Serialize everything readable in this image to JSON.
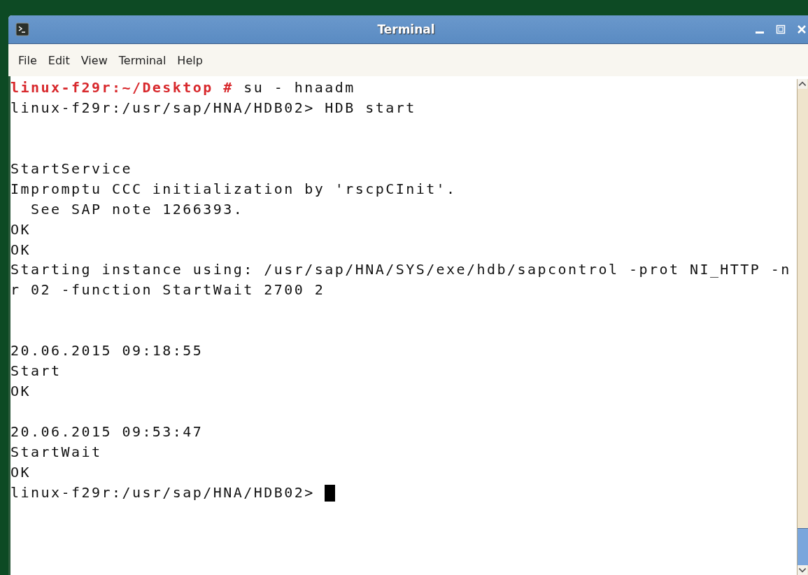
{
  "window": {
    "title": "Terminal"
  },
  "menu": [
    "File",
    "Edit",
    "View",
    "Terminal",
    "Help"
  ],
  "lines": [
    {
      "kind": "root_prompt",
      "prompt": "linux-f29r:~/Desktop #",
      "command": " su - hnaadm"
    },
    {
      "kind": "output",
      "text": "linux-f29r:/usr/sap/HNA/HDB02> HDB start"
    },
    {
      "kind": "blank"
    },
    {
      "kind": "blank"
    },
    {
      "kind": "output",
      "text": "StartService"
    },
    {
      "kind": "output",
      "text": "Impromptu CCC initialization by 'rscpCInit'."
    },
    {
      "kind": "output",
      "text": "  See SAP note 1266393."
    },
    {
      "kind": "output",
      "text": "OK"
    },
    {
      "kind": "output",
      "text": "OK"
    },
    {
      "kind": "output",
      "text": "Starting instance using: /usr/sap/HNA/SYS/exe/hdb/sapcontrol -prot NI_HTTP -n"
    },
    {
      "kind": "output",
      "text": "r 02 -function StartWait 2700 2"
    },
    {
      "kind": "blank"
    },
    {
      "kind": "blank"
    },
    {
      "kind": "output",
      "text": "20.06.2015 09:18:55"
    },
    {
      "kind": "output",
      "text": "Start"
    },
    {
      "kind": "output",
      "text": "OK"
    },
    {
      "kind": "blank"
    },
    {
      "kind": "output",
      "text": "20.06.2015 09:53:47"
    },
    {
      "kind": "output",
      "text": "StartWait"
    },
    {
      "kind": "output",
      "text": "OK"
    },
    {
      "kind": "cursor_line",
      "text": "linux-f29r:/usr/sap/HNA/HDB02> "
    }
  ]
}
